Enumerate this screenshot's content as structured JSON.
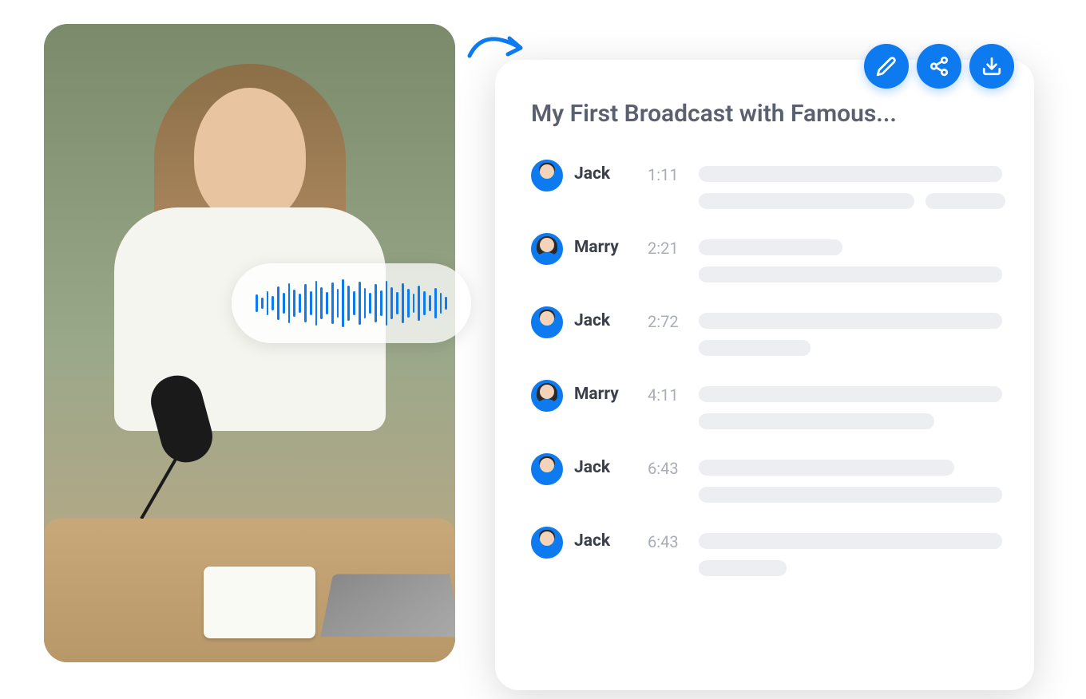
{
  "transcript": {
    "title": "My First Broadcast with Famous...",
    "entries": [
      {
        "speaker": "Jack",
        "time": "1:11",
        "gender": "male",
        "lines": [
          [
            380
          ],
          [
            270,
            100
          ]
        ]
      },
      {
        "speaker": "Marry",
        "time": "2:21",
        "gender": "female",
        "lines": [
          [
            180
          ],
          [
            380
          ]
        ]
      },
      {
        "speaker": "Jack",
        "time": "2:72",
        "gender": "male",
        "lines": [
          [
            380
          ],
          [
            140
          ]
        ]
      },
      {
        "speaker": "Marry",
        "time": "4:11",
        "gender": "female",
        "lines": [
          [
            380
          ],
          [
            295
          ]
        ]
      },
      {
        "speaker": "Jack",
        "time": "6:43",
        "gender": "male",
        "lines": [
          [
            320
          ],
          [
            380
          ]
        ]
      },
      {
        "speaker": "Jack",
        "time": "6:43",
        "gender": "male",
        "lines": [
          [
            380
          ],
          [
            110
          ]
        ]
      }
    ]
  },
  "actions": {
    "edit": "edit",
    "share": "share",
    "download": "download"
  },
  "colors": {
    "primary": "#0d7af0",
    "placeholder": "#eceef2"
  },
  "waveform": [
    22,
    14,
    30,
    18,
    42,
    26,
    50,
    34,
    24,
    48,
    30,
    56,
    40,
    28,
    52,
    36,
    60,
    44,
    30,
    54,
    38,
    26,
    48,
    32,
    56,
    40,
    28,
    50,
    36,
    24,
    44,
    30,
    20,
    38,
    26,
    16
  ]
}
